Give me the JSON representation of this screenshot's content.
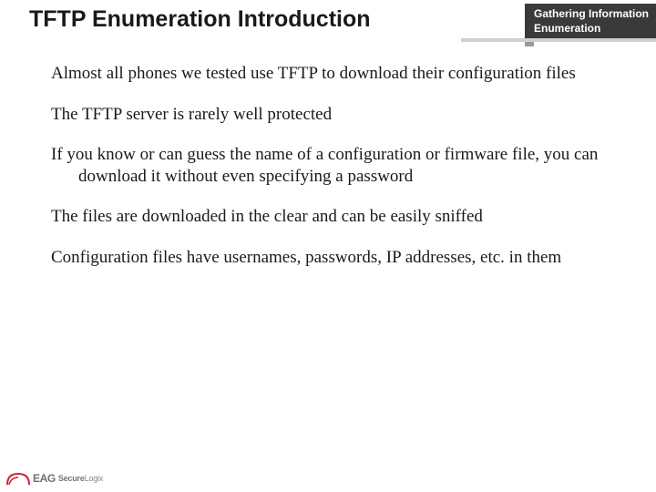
{
  "header": {
    "title": "TFTP Enumeration Introduction",
    "tag_line1": "Gathering Information",
    "tag_line2": "Enumeration"
  },
  "bullets": {
    "b0": "Almost all phones we tested use TFTP to download their configuration files",
    "b1": "The TFTP server is rarely well protected",
    "b2": "If you know or can guess the name of a configuration or firmware file, you can download it without even specifying a password",
    "b3": "The files are downloaded in the clear and can be easily sniffed",
    "b4": "Configuration files have usernames, passwords, IP addresses, etc. in them"
  },
  "footer": {
    "brand_short": "EAG",
    "brand_long_bold": "Secure",
    "brand_long_light": "Logix"
  }
}
